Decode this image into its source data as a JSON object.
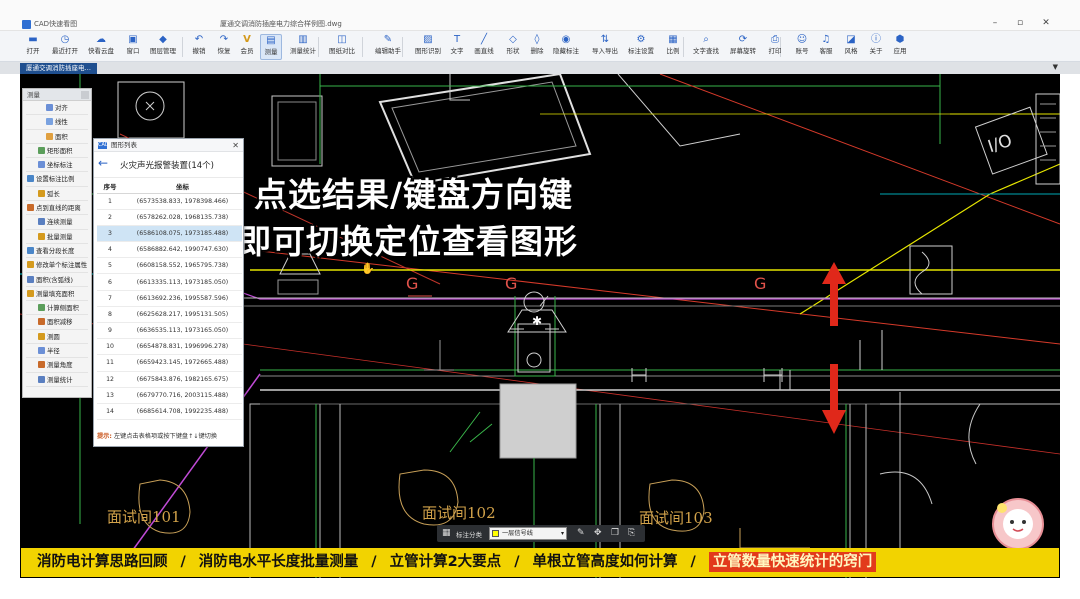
{
  "titlebar": {
    "app_name": "CAD快速看图",
    "document_title": "厦通交调消防插座电力综合样例图.dwg",
    "min": "–",
    "max": "▫",
    "close": "✕"
  },
  "ribbon": {
    "buttons": [
      {
        "label": "打开",
        "icon": "folder-icon"
      },
      {
        "label": "最近打开",
        "icon": "clock-icon"
      },
      {
        "label": "快看云盘",
        "icon": "cloud-icon"
      },
      {
        "label": "窗口",
        "icon": "window-icon"
      },
      {
        "label": "图层管理",
        "icon": "layers-icon"
      },
      {
        "label": "撤销",
        "icon": "undo-icon"
      },
      {
        "label": "恢复",
        "icon": "redo-icon"
      },
      {
        "label": "会员",
        "icon": "vip-icon"
      },
      {
        "label": "测量",
        "icon": "ruler-icon"
      },
      {
        "label": "测量统计",
        "icon": "stats-icon"
      },
      {
        "label": "图纸对比",
        "icon": "compare-icon"
      },
      {
        "label": "编辑助手",
        "icon": "edit-icon"
      },
      {
        "label": "图形识别",
        "icon": "recognize-icon"
      },
      {
        "label": "文字",
        "icon": "text-icon"
      },
      {
        "label": "画直线",
        "icon": "line-icon"
      },
      {
        "label": "形状",
        "icon": "shape-icon"
      },
      {
        "label": "删除",
        "icon": "eraser-icon"
      },
      {
        "label": "隐藏标注",
        "icon": "eye-icon"
      },
      {
        "label": "导入导出",
        "icon": "import-export-icon"
      },
      {
        "label": "标注设置",
        "icon": "settings-icon"
      },
      {
        "label": "比例",
        "icon": "scale-icon"
      },
      {
        "label": "文字查找",
        "icon": "search-icon"
      },
      {
        "label": "屏幕旋转",
        "icon": "rotate-icon"
      },
      {
        "label": "打印",
        "icon": "printer-icon"
      },
      {
        "label": "账号",
        "icon": "user-icon"
      },
      {
        "label": "客服",
        "icon": "headset-icon"
      },
      {
        "label": "风格",
        "icon": "style-icon"
      },
      {
        "label": "关于",
        "icon": "info-icon"
      },
      {
        "label": "应用",
        "icon": "apps-icon"
      }
    ]
  },
  "doc_tab": "厦通交调消防插座电…",
  "tab_menu": "▼",
  "measure_panel": {
    "header": "测量",
    "items": [
      "对齐",
      "线性",
      "面积",
      "矩形面积",
      "坐标标注",
      "设置标注比例",
      "弧长",
      "点到直线的距离",
      "连续测量",
      "批量测量",
      "查看分段长度",
      "修改单个标注属性",
      "面积(含弧线)",
      "测量填充面积",
      "计算侧面积",
      "面积减移",
      "测圆",
      "半径",
      "测量角度",
      "测量统计"
    ]
  },
  "shape_dialog": {
    "title": "图形列表",
    "close": "✕",
    "back": "←",
    "group_title": "火灾声光报警装置(14个)",
    "col_no": "序号",
    "col_coord": "坐标",
    "selected_row": 3,
    "rows": [
      [
        "1",
        "(6573538.833, 1978398.466)"
      ],
      [
        "2",
        "(6578262.028, 1968135.738)"
      ],
      [
        "3",
        "(6586108.075, 1973185.488)"
      ],
      [
        "4",
        "(6586882.642, 1990747.630)"
      ],
      [
        "5",
        "(6608158.552, 1965795.738)"
      ],
      [
        "6",
        "(6613335.113, 1973185.050)"
      ],
      [
        "7",
        "(6613692.236, 1995587.596)"
      ],
      [
        "8",
        "(6625628.217, 1995131.505)"
      ],
      [
        "9",
        "(6636535.113, 1973165.050)"
      ],
      [
        "10",
        "(6654878.831, 1996996.278)"
      ],
      [
        "11",
        "(6659423.145, 1972665.488)"
      ],
      [
        "12",
        "(6675843.876, 1982165.675)"
      ],
      [
        "13",
        "(6679770.716, 2003115.488)"
      ],
      [
        "14",
        "(6685614.708, 1992235.488)"
      ]
    ],
    "hint_label": "提示:",
    "hint_text": "左键点击表格项或按下键盘↑↓键切换"
  },
  "caption": {
    "line1": "点选结果/键盘方向键",
    "line2": "即可切换定位查看图形"
  },
  "drawing_labels": {
    "room_101": "面试间101",
    "room_102": "面试间102",
    "room_103": "面试间103",
    "io": "I/O",
    "g1": "G",
    "g2": "G",
    "g3": "G"
  },
  "status_strip": {
    "label": "标注分类",
    "layer": "一层信号线",
    "dropdown": "▾"
  },
  "subtitle": {
    "items": [
      "消防电计算思路回顾",
      "消防电水平长度批量测量",
      "立管计算2大要点",
      "单根立管高度如何计算"
    ],
    "separator": "/",
    "highlight": "立管数量快速统计的窍门"
  },
  "colors": {
    "canvas": "#000000",
    "accent": "#2b63c5",
    "selected_row": "#cfe4f5",
    "subtitle_bg": "#f2d300",
    "highlight_bg": "#e23a1b",
    "arrow": "#e0281a"
  }
}
